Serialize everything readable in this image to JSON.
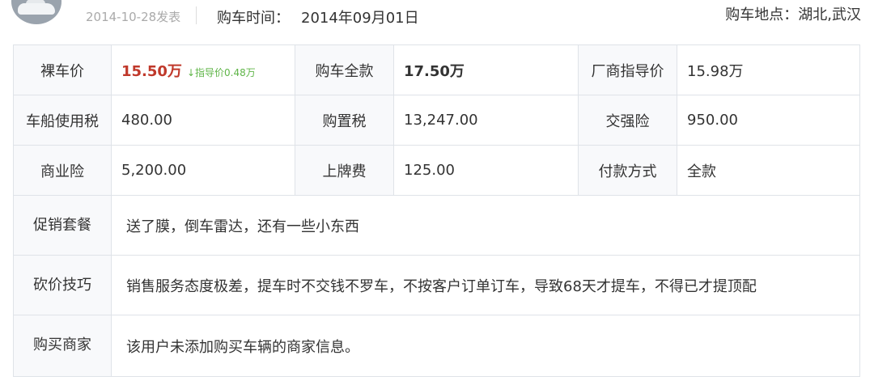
{
  "header": {
    "post_date": "2014-10-28发表",
    "buy_time_label": "购车时间：",
    "buy_time_value": "2014年09月01日",
    "buy_place": "购车地点：湖北,武汉"
  },
  "table": {
    "row1": {
      "naked_price_label": "裸车价",
      "naked_price_value": "15.50万",
      "guide_hint": "指导价0.48万",
      "full_price_label": "购车全款",
      "full_price_value": "17.50万",
      "msrp_label": "厂商指导价",
      "msrp_value": "15.98万"
    },
    "row2": {
      "vessel_tax_label": "车船使用税",
      "vessel_tax_value": "480.00",
      "purchase_tax_label": "购置税",
      "purchase_tax_value": "13,247.00",
      "compulsory_ins_label": "交强险",
      "compulsory_ins_value": "950.00"
    },
    "row3": {
      "commercial_ins_label": "商业险",
      "commercial_ins_value": "5,200.00",
      "plate_fee_label": "上牌费",
      "plate_fee_value": "125.00",
      "payment_label": "付款方式",
      "payment_value": "全款"
    },
    "promo_label": "促销套餐",
    "promo_value": "送了膜，倒车雷达，还有一些小东西",
    "bargain_label": "砍价技巧",
    "bargain_value": "销售服务态度极差，提车时不交钱不罗车，不按客户订单订车，导致68天才提车，不得已才提顶配",
    "dealer_label": "购买商家",
    "dealer_value": "该用户未添加购买车辆的商家信息。"
  },
  "colors": {
    "price_red": "#c0392b",
    "hint_green": "#5fb548",
    "label_bg": "#f8f9fb",
    "border": "#dfe3e8"
  }
}
